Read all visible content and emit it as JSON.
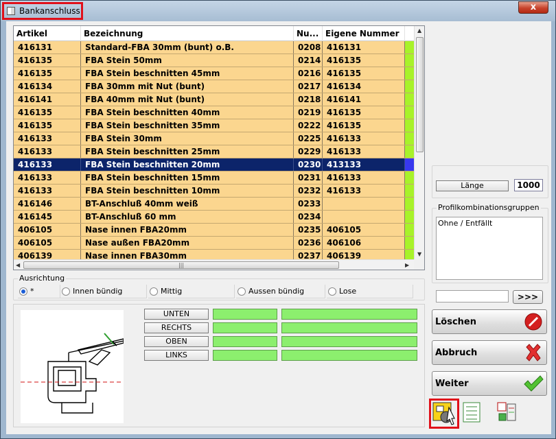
{
  "window": {
    "title": "Bankanschluss",
    "close_glyph": "x"
  },
  "table": {
    "columns": [
      "Artikel",
      "Bezeichnung",
      "Nu...",
      "Eigene Nummer"
    ],
    "rows": [
      {
        "artikel": "416131",
        "bezeichnung": "Standard-FBA 30mm (bunt) o.B.",
        "nummer": "0208",
        "eigene": "416131",
        "selected": false
      },
      {
        "artikel": "416135",
        "bezeichnung": "FBA Stein 50mm",
        "nummer": "0214",
        "eigene": "416135",
        "selected": false
      },
      {
        "artikel": "416135",
        "bezeichnung": "FBA Stein beschnitten 45mm",
        "nummer": "0216",
        "eigene": "416135",
        "selected": false
      },
      {
        "artikel": "416134",
        "bezeichnung": "FBA 30mm mit Nut (bunt)",
        "nummer": "0217",
        "eigene": "416134",
        "selected": false
      },
      {
        "artikel": "416141",
        "bezeichnung": "FBA 40mm mit Nut (bunt)",
        "nummer": "0218",
        "eigene": "416141",
        "selected": false
      },
      {
        "artikel": "416135",
        "bezeichnung": "FBA Stein beschnitten 40mm",
        "nummer": "0219",
        "eigene": "416135",
        "selected": false
      },
      {
        "artikel": "416135",
        "bezeichnung": "FBA Stein beschnitten 35mm",
        "nummer": "0222",
        "eigene": "416135",
        "selected": false
      },
      {
        "artikel": "416133",
        "bezeichnung": "FBA Stein 30mm",
        "nummer": "0225",
        "eigene": "416133",
        "selected": false
      },
      {
        "artikel": "416133",
        "bezeichnung": "FBA Stein beschnitten 25mm",
        "nummer": "0229",
        "eigene": "416133",
        "selected": false
      },
      {
        "artikel": "416133",
        "bezeichnung": "FBA Stein beschnitten 20mm",
        "nummer": "0230",
        "eigene": "413133",
        "selected": true
      },
      {
        "artikel": "416133",
        "bezeichnung": "FBA Stein beschnitten 15mm",
        "nummer": "0231",
        "eigene": "416133",
        "selected": false
      },
      {
        "artikel": "416133",
        "bezeichnung": "FBA Stein beschnitten 10mm",
        "nummer": "0232",
        "eigene": "416133",
        "selected": false
      },
      {
        "artikel": "416146",
        "bezeichnung": "BT-Anschluß 40mm weiß",
        "nummer": "0233",
        "eigene": "",
        "selected": false
      },
      {
        "artikel": "416145",
        "bezeichnung": "BT-Anschluß 60 mm",
        "nummer": "0234",
        "eigene": "",
        "selected": false
      },
      {
        "artikel": "406105",
        "bezeichnung": "Nase innen FBA20mm",
        "nummer": "0235",
        "eigene": "406105",
        "selected": false
      },
      {
        "artikel": "406105",
        "bezeichnung": "Nase außen FBA20mm",
        "nummer": "0236",
        "eigene": "406106",
        "selected": false
      },
      {
        "artikel": "406139",
        "bezeichnung": "Nase innen FBA30mm",
        "nummer": "0237",
        "eigene": "406139",
        "selected": false
      }
    ]
  },
  "ausrichtung": {
    "legend": "Ausrichtung",
    "options": [
      {
        "label": "*",
        "checked": true
      },
      {
        "label": "Innen bündig",
        "checked": false
      },
      {
        "label": "Mittig",
        "checked": false
      },
      {
        "label": "Aussen bündig",
        "checked": false
      },
      {
        "label": "Lose",
        "checked": false
      }
    ]
  },
  "sides": [
    "UNTEN",
    "RECHTS",
    "OBEN",
    "LINKS"
  ],
  "right_panel": {
    "length_label": "Länge",
    "length_value": "1000",
    "groups_legend": "Profilkombinationsgruppen",
    "groups_items": [
      "Ohne / Entfällt"
    ],
    "more_button": ">>>"
  },
  "actions": {
    "delete": "Löschen",
    "cancel": "Abbruch",
    "next": "Weiter"
  },
  "colors": {
    "row_bg": "#fbd68f",
    "selected_bg": "#0c246a",
    "marker_green": "#a8f22a",
    "marker_selected": "#3838ee",
    "status_green": "#8cef6e",
    "highlight_red": "#e0101a"
  }
}
